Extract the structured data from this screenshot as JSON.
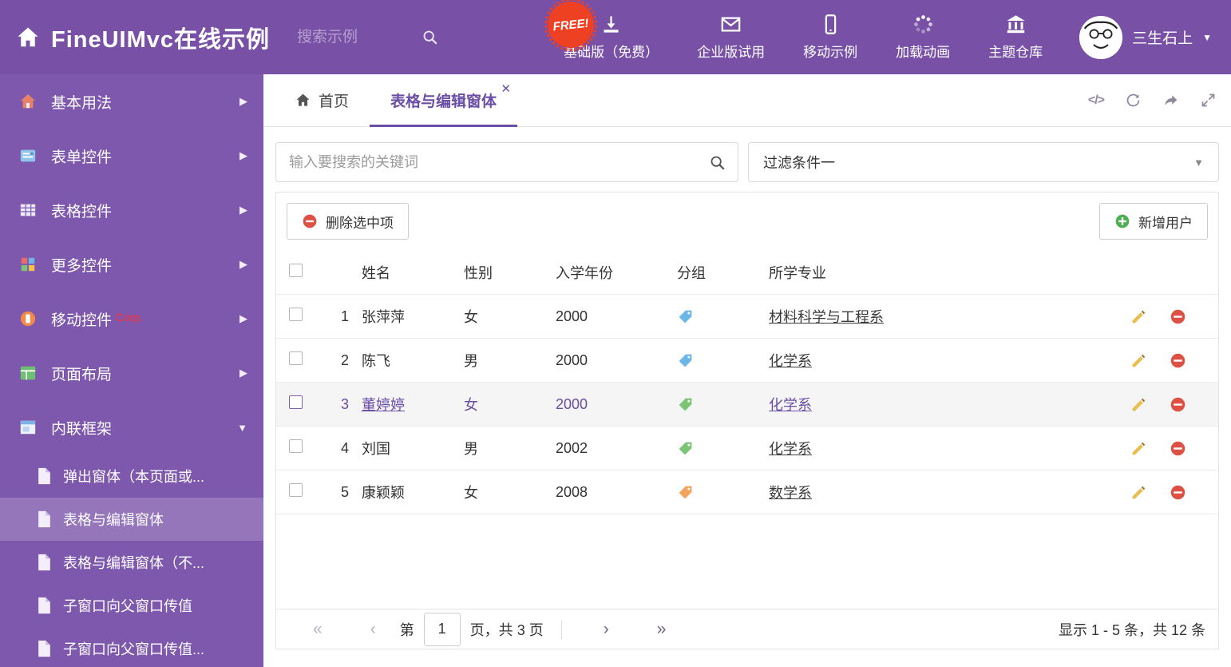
{
  "colors": {
    "header_bg": "#7851a6",
    "sidebar_bg": "#7e58ad",
    "accent": "#6a4da5",
    "free_badge_bg": "#ee4023",
    "delete_red": "#dd5145",
    "add_green": "#4caf50"
  },
  "header": {
    "title": "FineUIMvc在线示例",
    "search_placeholder": "搜索示例",
    "free_badge": "FREE!",
    "nav": [
      {
        "label": "基础版（免费）",
        "icon": "download-icon"
      },
      {
        "label": "企业版试用",
        "icon": "envelope-icon"
      },
      {
        "label": "移动示例",
        "icon": "mobile-icon"
      },
      {
        "label": "加载动画",
        "icon": "spinner-icon"
      },
      {
        "label": "主题仓库",
        "icon": "bank-icon"
      }
    ],
    "user_name": "三生石上"
  },
  "sidebar": {
    "items": [
      {
        "label": "基本用法"
      },
      {
        "label": "表单控件"
      },
      {
        "label": "表格控件"
      },
      {
        "label": "更多控件"
      },
      {
        "label": "移动控件",
        "badge": "Corp."
      },
      {
        "label": "页面布局"
      },
      {
        "label": "内联框架"
      }
    ],
    "subitems": [
      {
        "label": "弹出窗体（本页面或..."
      },
      {
        "label": "表格与编辑窗体"
      },
      {
        "label": "表格与编辑窗体（不..."
      },
      {
        "label": "子窗口向父窗口传值"
      },
      {
        "label": "子窗口向父窗口传值..."
      }
    ]
  },
  "tabbar": {
    "home_tab": "首页",
    "active_tab": "表格与编辑窗体",
    "code_icon_text": "</>"
  },
  "filter_row": {
    "search_placeholder": "输入要搜索的关键词",
    "filter_value": "过滤条件一"
  },
  "toolbar": {
    "delete_label": "删除选中项",
    "add_label": "新增用户"
  },
  "table": {
    "headers": {
      "name": "姓名",
      "gender": "性别",
      "year": "入学年份",
      "group": "分组",
      "major": "所学专业"
    },
    "rows": [
      {
        "index": "1",
        "name": "张萍萍",
        "gender": "女",
        "year": "2000",
        "tag_color": "#6ab6e8",
        "major": "材料科学与工程系"
      },
      {
        "index": "2",
        "name": "陈飞",
        "gender": "男",
        "year": "2000",
        "tag_color": "#6ab6e8",
        "major": "化学系"
      },
      {
        "index": "3",
        "name": "董婷婷",
        "gender": "女",
        "year": "2000",
        "tag_color": "#7cc576",
        "major": "化学系"
      },
      {
        "index": "4",
        "name": "刘国",
        "gender": "男",
        "year": "2002",
        "tag_color": "#7cc576",
        "major": "化学系"
      },
      {
        "index": "5",
        "name": "康颖颖",
        "gender": "女",
        "year": "2008",
        "tag_color": "#f2a45c",
        "major": "数学系"
      }
    ]
  },
  "pagination": {
    "page_prefix": "第",
    "current_page": "1",
    "page_suffix": "页，共 3 页",
    "summary": "显示 1 - 5 条，共 12 条"
  }
}
